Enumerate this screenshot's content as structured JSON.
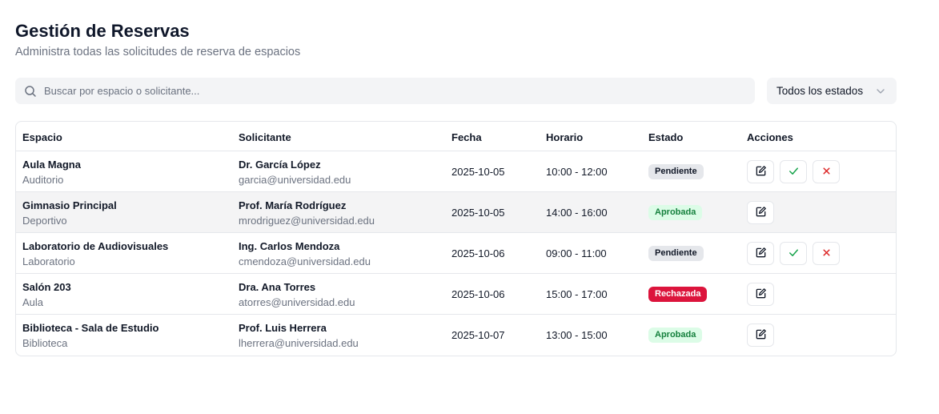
{
  "header": {
    "title": "Gestión de Reservas",
    "subtitle": "Administra todas las solicitudes de reserva de espacios"
  },
  "search": {
    "placeholder": "Buscar por espacio o solicitante...",
    "value": "",
    "icon": "search-icon"
  },
  "filter": {
    "selected": "Todos los estados",
    "icon": "chevron-down-icon"
  },
  "table": {
    "columns": {
      "espacio": "Espacio",
      "solicitante": "Solicitante",
      "fecha": "Fecha",
      "horario": "Horario",
      "estado": "Estado",
      "acciones": "Acciones"
    },
    "rows": [
      {
        "space": "Aula Magna",
        "type": "Auditorio",
        "requester": "Dr. García López",
        "email": "garcia@universidad.edu",
        "date": "2025-10-05",
        "time": "10:00 - 12:00",
        "status": "Pendiente"
      },
      {
        "space": "Gimnasio Principal",
        "type": "Deportivo",
        "requester": "Prof. María Rodríguez",
        "email": "mrodriguez@universidad.edu",
        "date": "2025-10-05",
        "time": "14:00 - 16:00",
        "status": "Aprobada"
      },
      {
        "space": "Laboratorio de Audiovisuales",
        "type": "Laboratorio",
        "requester": "Ing. Carlos Mendoza",
        "email": "cmendoza@universidad.edu",
        "date": "2025-10-06",
        "time": "09:00 - 11:00",
        "status": "Pendiente"
      },
      {
        "space": "Salón 203",
        "type": "Aula",
        "requester": "Dra. Ana Torres",
        "email": "atorres@universidad.edu",
        "date": "2025-10-06",
        "time": "15:00 - 17:00",
        "status": "Rechazada"
      },
      {
        "space": "Biblioteca - Sala de Estudio",
        "type": "Biblioteca",
        "requester": "Prof. Luis Herrera",
        "email": "lherrera@universidad.edu",
        "date": "2025-10-07",
        "time": "13:00 - 15:00",
        "status": "Aprobada"
      }
    ]
  },
  "colors": {
    "approve": "#16a34a",
    "reject": "#dc2626",
    "rejected_badge": "#dc143c",
    "approved_badge_bg": "#dcfce7",
    "approved_badge_text": "#15803d"
  },
  "icons": {
    "edit": "edit-icon",
    "approve": "check-icon",
    "reject": "x-icon"
  }
}
